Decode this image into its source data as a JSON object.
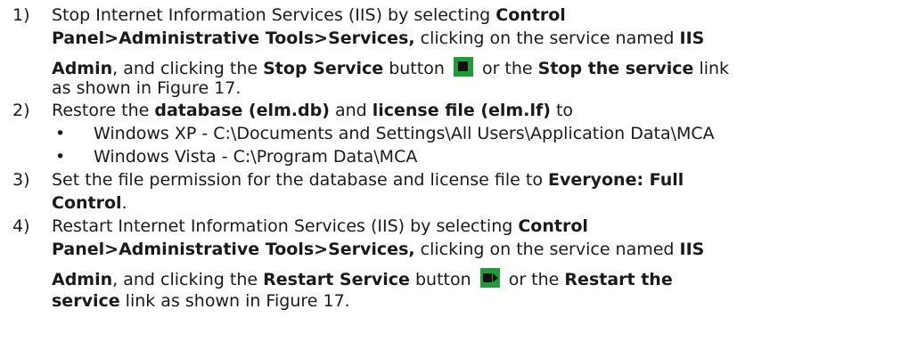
{
  "steps": [
    {
      "num": "1)",
      "l1a": "Stop Internet Information Services (IIS) by selecting ",
      "l1b": "Control",
      "l2a": "Panel>Administrative Tools>Services,",
      "l2b": " clicking on the service named ",
      "l2c": "IIS",
      "l3a": "Admin",
      "l3b": ", and clicking the ",
      "l3c": "Stop Service",
      "l3d": " button ",
      "l3e": " or the ",
      "l3f": "Stop the service",
      "l3g": " link",
      "l4": "as shown in Figure 17.",
      "icon": "stop-icon"
    },
    {
      "num": "2)",
      "l1a": "Restore the ",
      "l1b": "database (elm.db)",
      "l1c": " and ",
      "l1d": "license file (elm.lf)",
      "l1e": " to",
      "bullets": [
        "Windows XP - C:\\Documents and Settings\\All Users\\Application Data\\MCA",
        "Windows Vista - C:\\Program Data\\MCA"
      ]
    },
    {
      "num": "3)",
      "l1a": "Set the file permission for the database and license file to ",
      "l1b": "Everyone: Full",
      "l2a": "Control",
      "l2b": "."
    },
    {
      "num": "4)",
      "l1a": "Restart Internet Information Services (IIS) by selecting ",
      "l1b": "Control",
      "l2a": "Panel>Administrative Tools>Services,",
      "l2b": " clicking on the service named ",
      "l2c": "IIS",
      "l3a": "Admin",
      "l3b": ", and clicking the ",
      "l3c": "Restart Service",
      "l3d": " button ",
      "l3e": " or the ",
      "l3f": "Restart the",
      "l4a": "service",
      "l4b": " link as shown in Figure 17.",
      "icon": "restart-icon"
    }
  ]
}
